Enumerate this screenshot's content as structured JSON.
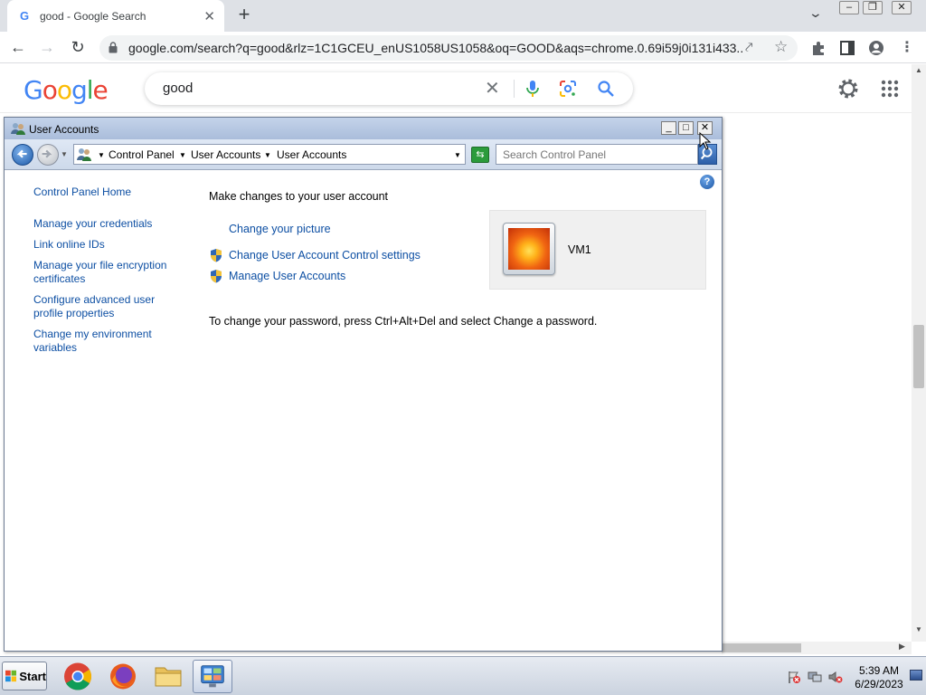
{
  "browser": {
    "tab_title": "good - Google Search",
    "tab_favicon": "G",
    "url": "google.com/search?q=good&rlz=1C1GCEU_enUS1058US1058&oq=GOOD&aqs=chrome.0.69i59j0i131i433...",
    "new_tab_symbol": "+",
    "tab_close_symbol": "✕",
    "window_controls": [
      "–",
      "❐",
      "✕"
    ]
  },
  "google": {
    "logo_letters": [
      "G",
      "o",
      "o",
      "g",
      "l",
      "e"
    ],
    "logo_colors": [
      "#4285f4",
      "#ea4335",
      "#fbbc05",
      "#4285f4",
      "#34a853",
      "#ea4335"
    ],
    "search_query": "good",
    "clear_symbol": "✕"
  },
  "window": {
    "title": "User Accounts",
    "caption_buttons": [
      "_",
      "□",
      "✕"
    ]
  },
  "address_bar": {
    "crumbs": [
      "Control Panel",
      "User Accounts",
      "User Accounts"
    ],
    "search_placeholder": "Search Control Panel"
  },
  "left_nav": {
    "home": "Control Panel Home",
    "links": [
      [
        "Manage your credentials"
      ],
      [
        "Link online IDs"
      ],
      [
        "Manage your file encryption",
        "certificates"
      ],
      [
        "Configure advanced user",
        "profile properties"
      ],
      [
        "Change my environment",
        "variables"
      ]
    ]
  },
  "main": {
    "heading": "Make changes to your user account",
    "change_picture": "Change your picture",
    "uac_settings": "Change User Account Control settings",
    "manage_accounts": "Manage User Accounts",
    "password_note": "To change your password, press Ctrl+Alt+Del and select Change a password."
  },
  "user": {
    "name": "VM1"
  },
  "help_symbol": "?",
  "taskbar": {
    "start_label": "Start",
    "time": "5:39 AM",
    "date": "6/29/2023",
    "pinned": [
      "chrome-icon",
      "firefox-icon",
      "file-explorer-icon",
      "control-panel-icon"
    ]
  }
}
